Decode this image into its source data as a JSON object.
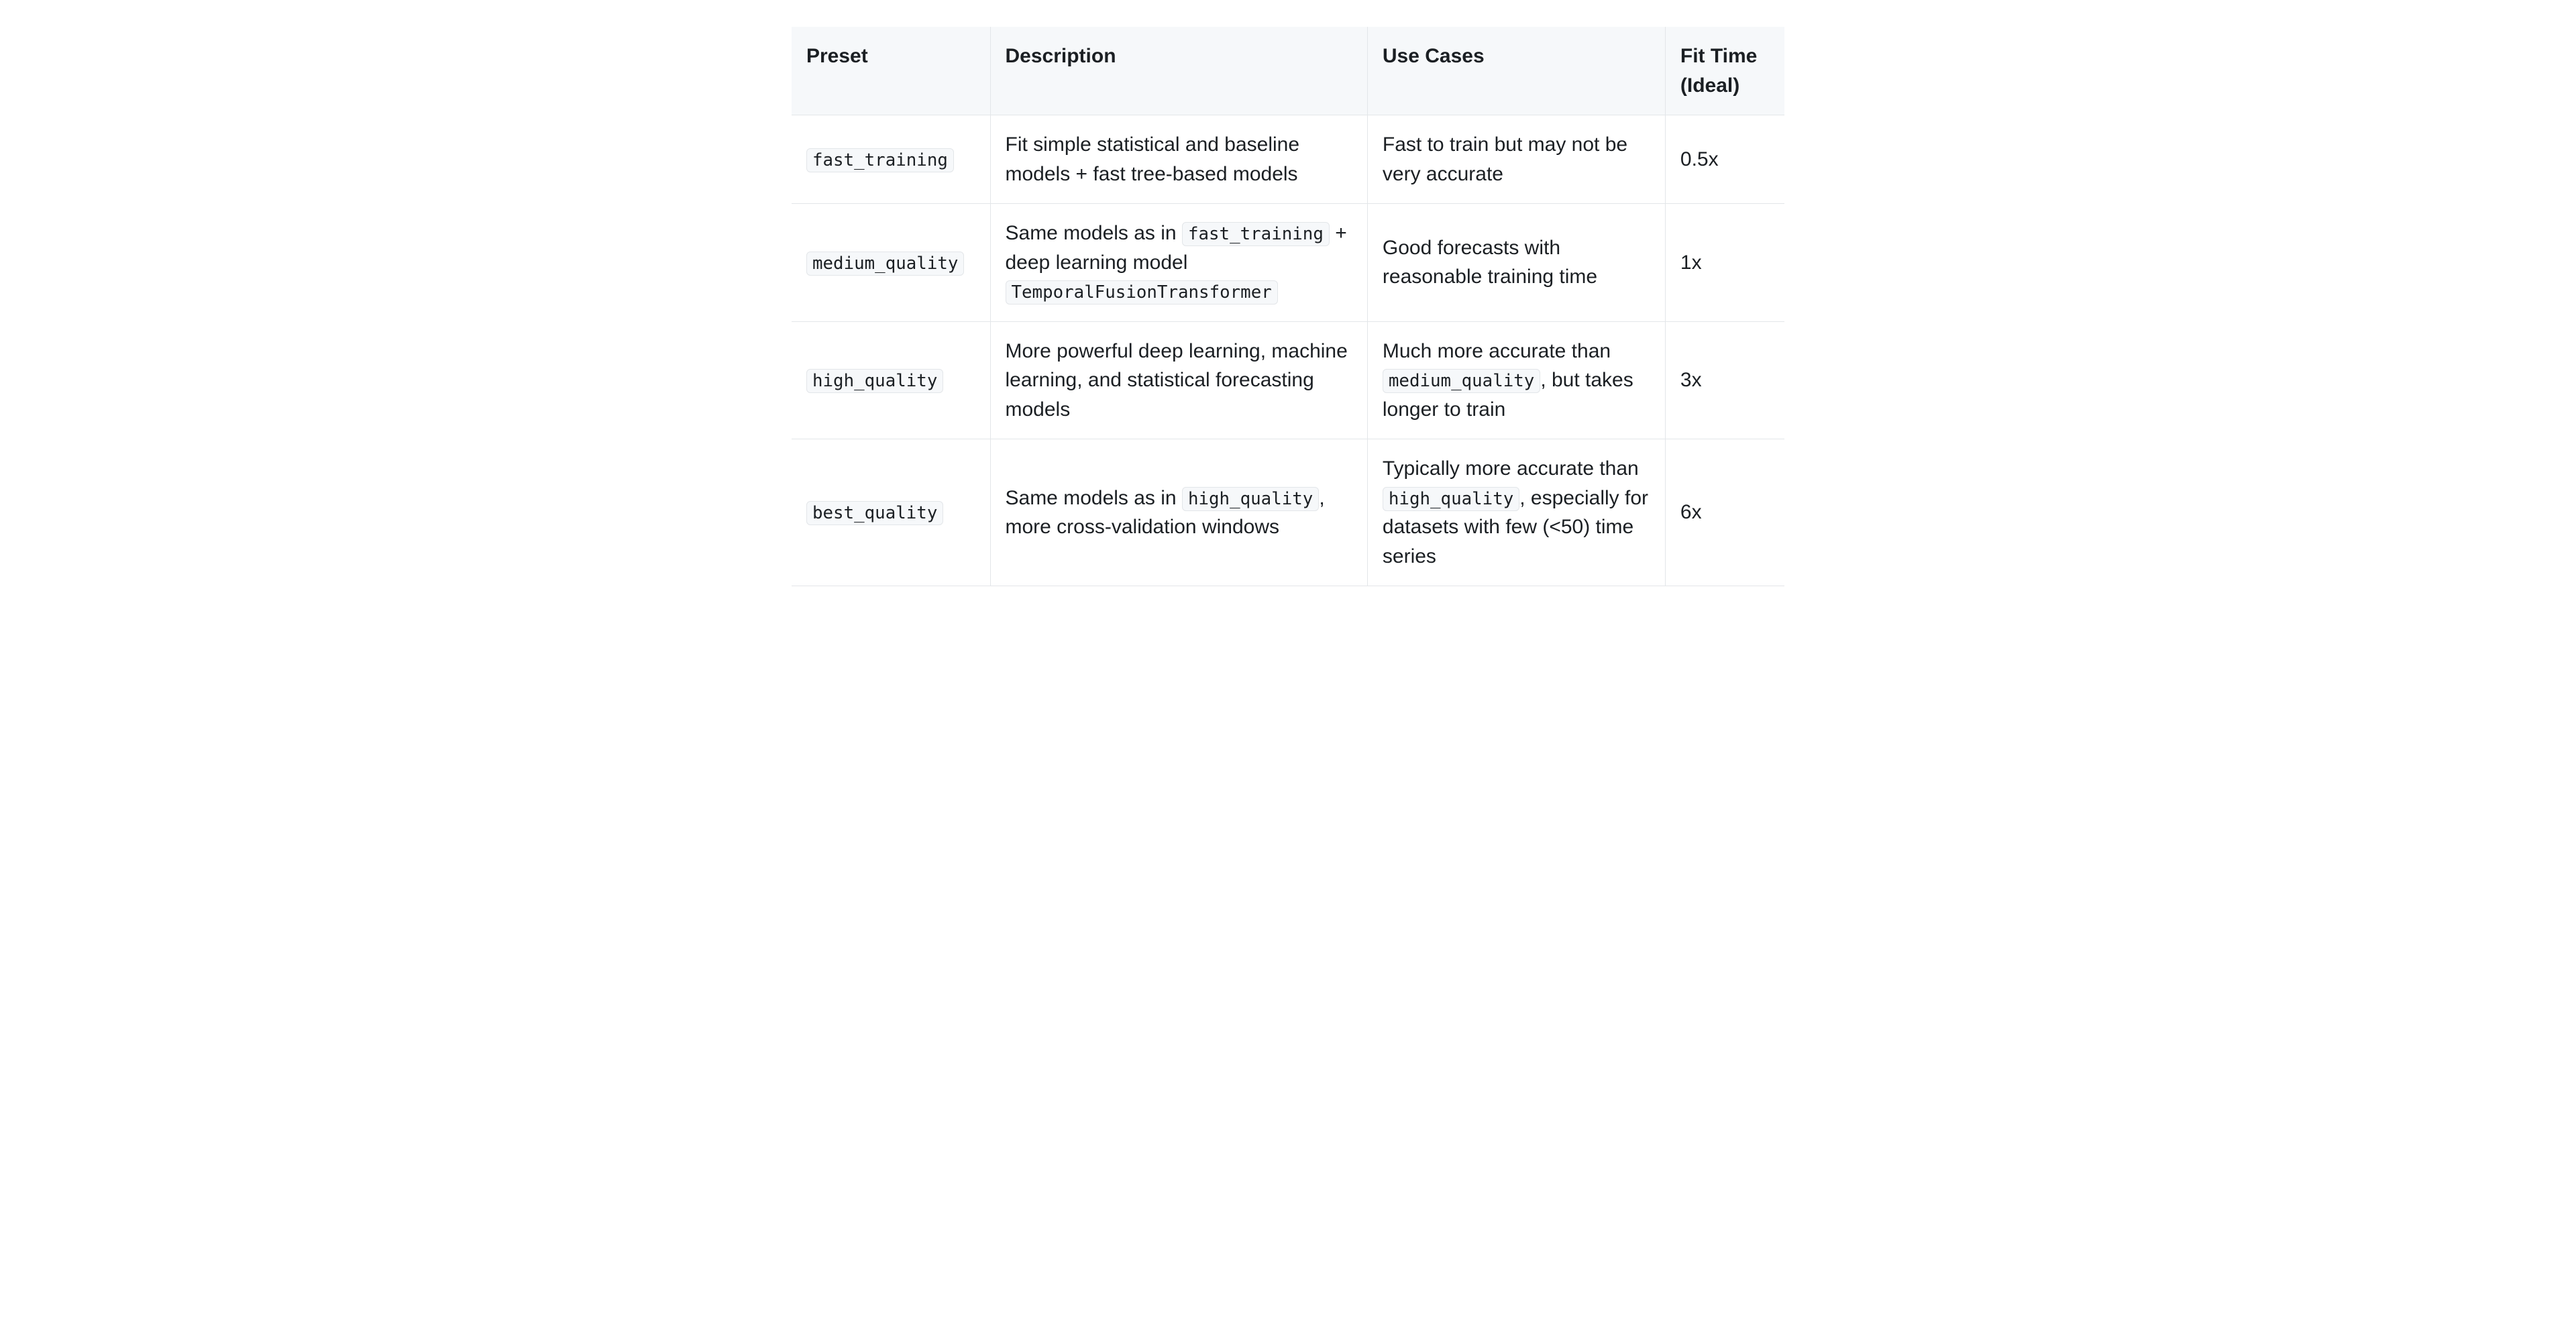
{
  "table": {
    "headers": {
      "preset": "Preset",
      "description": "Description",
      "use_cases": "Use Cases",
      "fit_time": "Fit Time (Ideal)"
    },
    "rows": [
      {
        "preset_code": "fast_training",
        "description": [
          {
            "type": "text",
            "value": "Fit simple statistical and baseline models + fast tree-based models"
          }
        ],
        "use_cases": [
          {
            "type": "text",
            "value": "Fast to train but may not be very accurate"
          }
        ],
        "fit_time": "0.5x"
      },
      {
        "preset_code": "medium_quality",
        "description": [
          {
            "type": "text",
            "value": "Same models as in "
          },
          {
            "type": "code",
            "value": "fast_training"
          },
          {
            "type": "text",
            "value": " + deep learning model "
          },
          {
            "type": "code",
            "value": "TemporalFusionTransformer"
          }
        ],
        "use_cases": [
          {
            "type": "text",
            "value": "Good forecasts with reasonable training time"
          }
        ],
        "fit_time": "1x"
      },
      {
        "preset_code": "high_quality",
        "description": [
          {
            "type": "text",
            "value": "More powerful deep learning, machine learning, and statistical forecasting models"
          }
        ],
        "use_cases": [
          {
            "type": "text",
            "value": "Much more accurate than "
          },
          {
            "type": "code",
            "value": "medium_quality"
          },
          {
            "type": "text",
            "value": ", but takes longer to train"
          }
        ],
        "fit_time": "3x"
      },
      {
        "preset_code": "best_quality",
        "description": [
          {
            "type": "text",
            "value": "Same models as in "
          },
          {
            "type": "code",
            "value": "high_quality"
          },
          {
            "type": "text",
            "value": ", more cross-validation windows"
          }
        ],
        "use_cases": [
          {
            "type": "text",
            "value": "Typically more accurate than "
          },
          {
            "type": "code",
            "value": "high_quality"
          },
          {
            "type": "text",
            "value": ", especially for datasets with few (<50) time series"
          }
        ],
        "fit_time": "6x"
      }
    ]
  }
}
